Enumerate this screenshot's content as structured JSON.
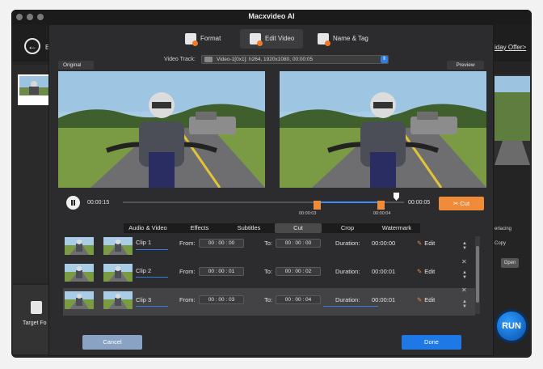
{
  "app": {
    "title": "Macxvideo AI"
  },
  "background": {
    "back_label": "E",
    "offer_label": "iday Offer>",
    "target_label": "Target Fo",
    "deinterlacing_label": "erlacing",
    "copy_label": "Copy",
    "open_label": "Open",
    "run_label": "RUN"
  },
  "dialog_tabs": [
    {
      "label": "Format",
      "icon": "format-icon"
    },
    {
      "label": "Edit Video",
      "icon": "edit-video-icon"
    },
    {
      "label": "Name & Tag",
      "icon": "name-tag-icon"
    }
  ],
  "video": {
    "original_label": "Original",
    "preview_label": "Preview",
    "track_label": "Video Track:",
    "track_value": "Video-1[0x1]: h264, 1920x1080, 00:00:05"
  },
  "playback": {
    "current_time": "00:00:15",
    "duration": "00:00:05",
    "trim_start": "00:00:03",
    "trim_end": "00:00:04",
    "cut_label": "Cut"
  },
  "sub_tabs": [
    "Audio & Video",
    "Effects",
    "Subtitles",
    "Cut",
    "Crop",
    "Watermark"
  ],
  "active_sub_tab": "Cut",
  "clip_labels": {
    "from": "From:",
    "to": "To:",
    "duration": "Duration:",
    "edit": "Edit"
  },
  "clips": [
    {
      "name": "Clip 1",
      "from": "00 : 00 : 00",
      "to": "00 : 00 : 00",
      "duration": "00:00:00"
    },
    {
      "name": "Clip 2",
      "from": "00 : 00 : 01",
      "to": "00 : 00 : 02",
      "duration": "00:00:01"
    },
    {
      "name": "Clip 3",
      "from": "00 : 00 : 03",
      "to": "00 : 00 : 04",
      "duration": "00:00:01"
    }
  ],
  "buttons": {
    "cancel": "Cancel",
    "done": "Done"
  },
  "colors": {
    "accent_orange": "#f08b3a",
    "accent_blue": "#1e78e6",
    "dialog_bg": "#2c2c2e"
  }
}
